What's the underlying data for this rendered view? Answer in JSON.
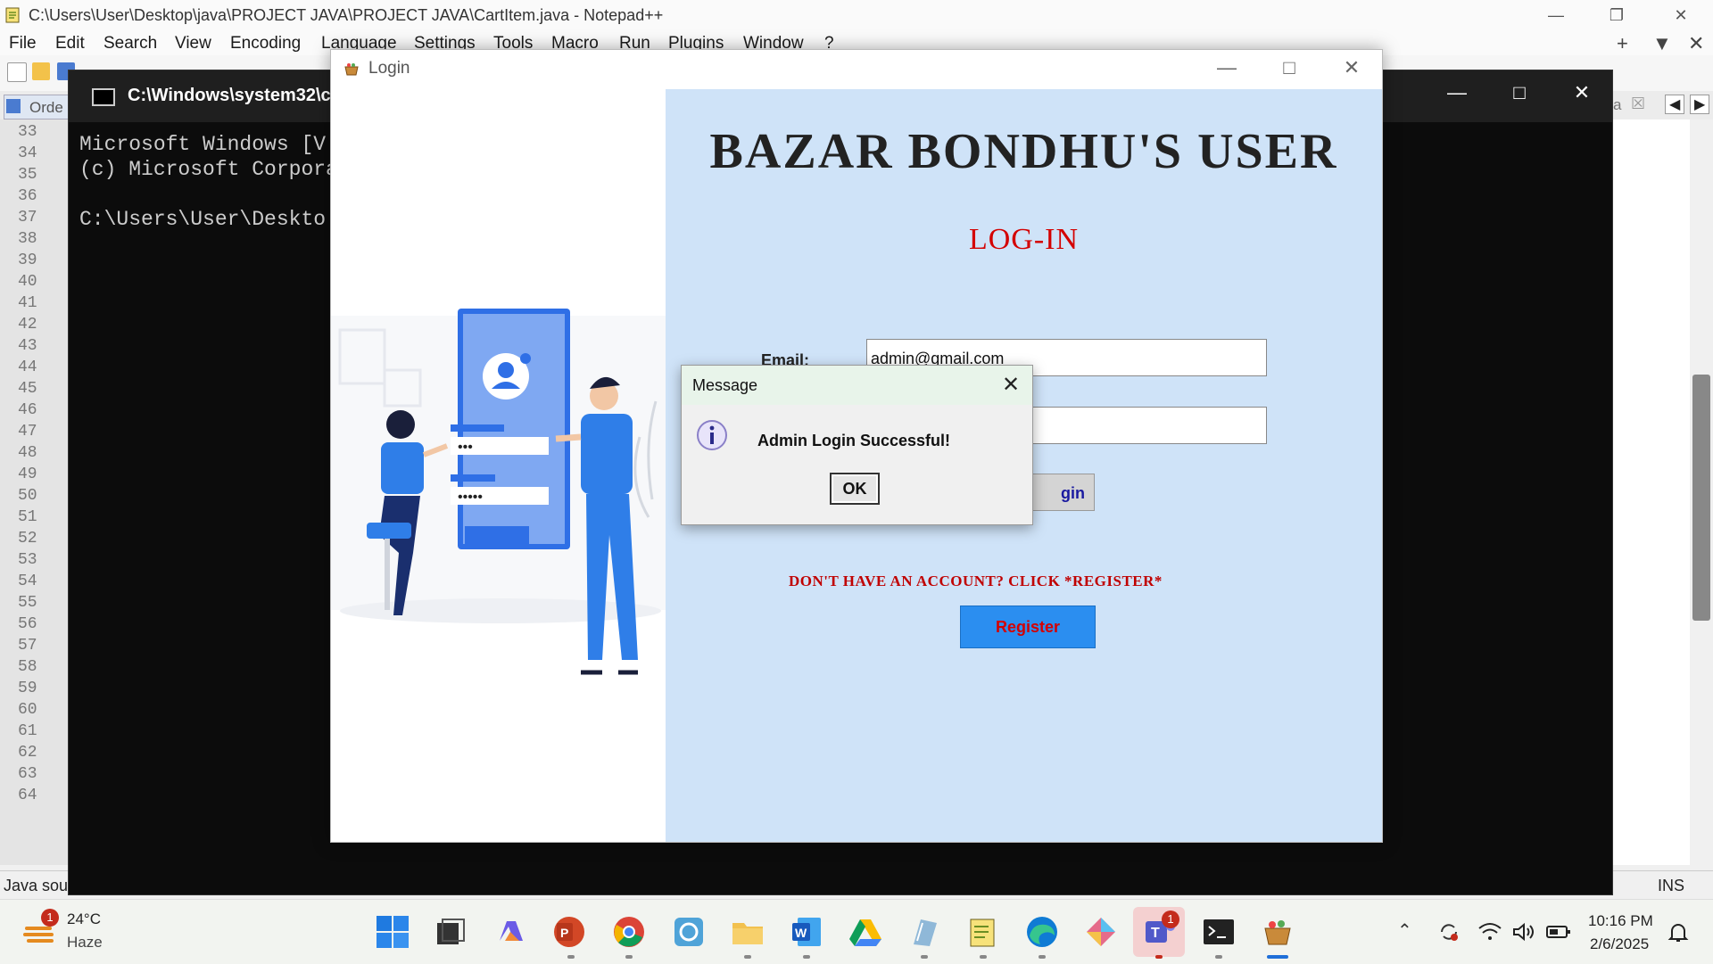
{
  "npp": {
    "title": "C:\\Users\\User\\Desktop\\java\\PROJECT JAVA\\PROJECT JAVA\\CartItem.java - Notepad++",
    "menu": [
      "File",
      "Edit",
      "Search",
      "View",
      "Encoding",
      "Language",
      "Settings",
      "Tools",
      "Macro",
      "Run",
      "Plugins",
      "Window",
      "?"
    ],
    "tab_partial": "Orde",
    "tab_right_partial": "a",
    "line_numbers": [
      "33",
      "34",
      "35",
      "36",
      "37",
      "38",
      "39",
      "40",
      "41",
      "42",
      "43",
      "44",
      "45",
      "46",
      "47",
      "48",
      "49",
      "50",
      "51",
      "52",
      "53",
      "54",
      "55",
      "56",
      "57",
      "58",
      "59",
      "60",
      "61",
      "62",
      "63",
      "64"
    ],
    "status_left": "Java sour",
    "status_right": "INS"
  },
  "cmd": {
    "title": "C:\\Windows\\system32\\c",
    "lines": [
      "Microsoft Windows [V",
      "(c) Microsoft Corpora",
      "",
      "C:\\Users\\User\\Deskto"
    ]
  },
  "login": {
    "title": "Login",
    "brand": "BAZAR BONDHU'S USER",
    "heading": "LOG-IN",
    "email_label": "Email:",
    "email_value": "admin@gmail.com",
    "login_button_partial": "gin",
    "signup_prompt": "DON'T HAVE AN ACCOUNT? CLICK *REGISTER*",
    "register_button": "Register"
  },
  "message": {
    "title": "Message",
    "text": "Admin Login Successful!",
    "ok": "OK"
  },
  "taskbar": {
    "weather_temp": "24°C",
    "weather_cond": "Haze",
    "weather_badge": "1",
    "teams_badge": "1",
    "time": "10:16 PM",
    "date": "2/6/2025"
  },
  "colors": {
    "form_bg": "#cfe3f8",
    "accent_red": "#d40000",
    "register_blue": "#2b8ef0"
  }
}
